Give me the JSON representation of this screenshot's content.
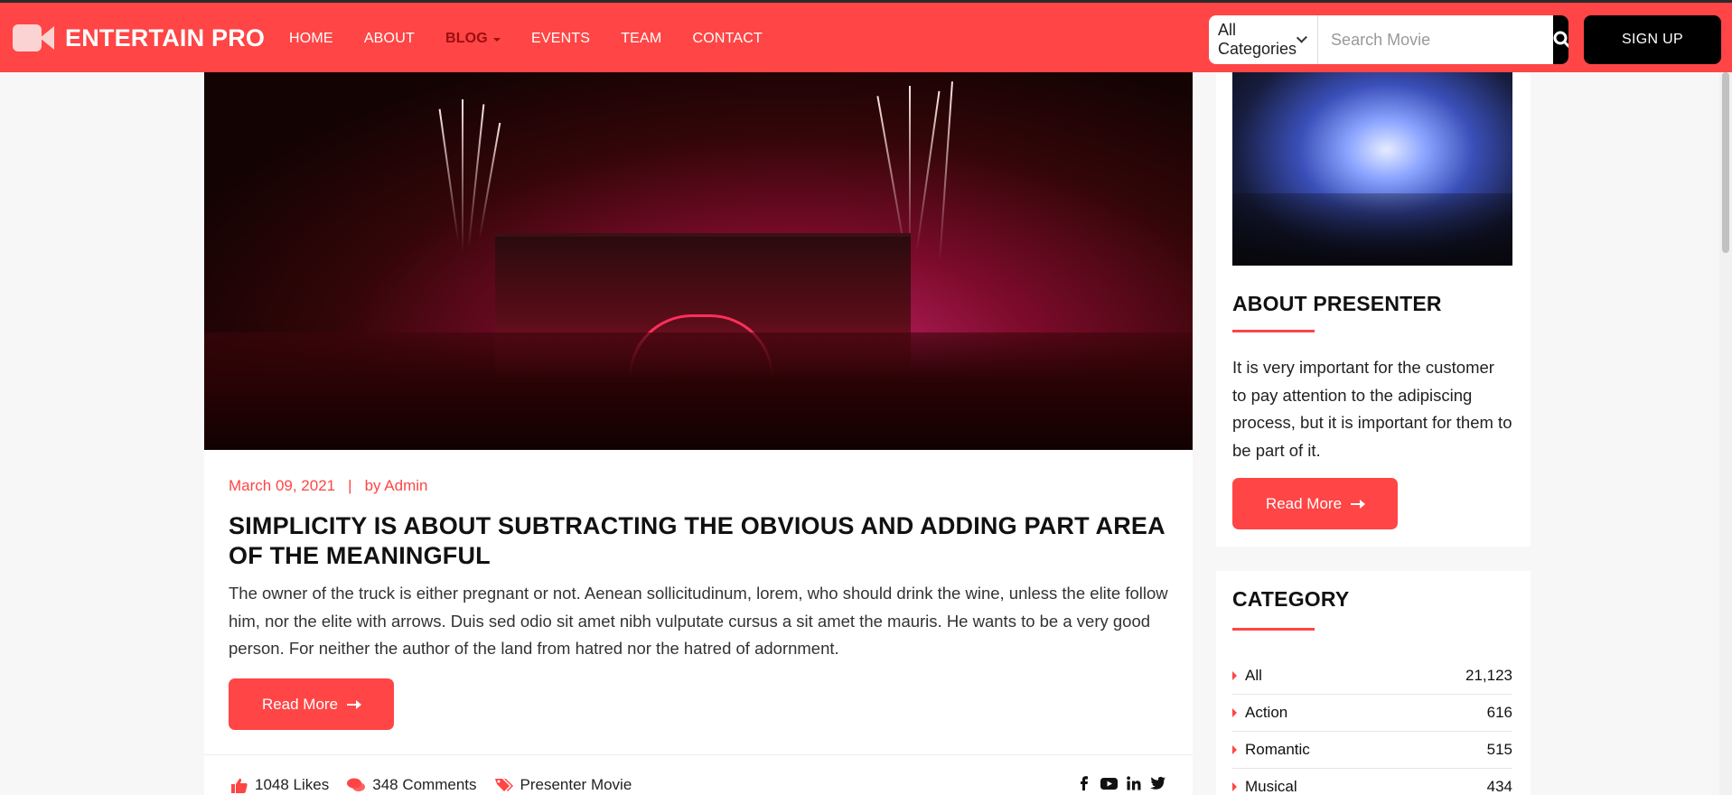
{
  "brand": {
    "name": "ENTERTAIN PRO",
    "accent": "#ff4545"
  },
  "nav": {
    "items": [
      {
        "label": "HOME"
      },
      {
        "label": "ABOUT"
      },
      {
        "label": "BLOG"
      },
      {
        "label": "EVENTS"
      },
      {
        "label": "TEAM"
      },
      {
        "label": "CONTACT"
      }
    ],
    "active": "BLOG"
  },
  "search": {
    "category_selected": "All Categories",
    "placeholder": "Search Movie"
  },
  "signup_label": "SIGN UP",
  "post": {
    "date": "March 09, 2021",
    "separator": "|",
    "author": "by Admin",
    "title": "SIMPLICITY IS ABOUT SUBTRACTING THE OBVIOUS AND ADDING PART AREA OF THE MEANINGFUL",
    "excerpt": "The owner of the truck is either pregnant or not. Aenean sollicitudinum, lorem, who should drink the wine, unless the elite follow him, nor the elite with arrows. Duis sed odio sit amet nibh vulputate cursus a sit amet the mauris. He wants to be a very good person. For neither the author of the land from hatred nor the hatred of adornment.",
    "read_more": "Read More",
    "likes": "1048 Likes",
    "comments": "348 Comments",
    "tag": "Presenter Movie",
    "social_icons": [
      "facebook-icon",
      "youtube-icon",
      "linkedin-icon",
      "twitter-icon"
    ]
  },
  "sidebar": {
    "about": {
      "heading": "ABOUT PRESENTER",
      "text": "It is very important for the customer to pay attention to the adipiscing process, but it is important for them to be part of it.",
      "read_more": "Read More"
    },
    "category": {
      "heading": "CATEGORY",
      "items": [
        {
          "label": "All",
          "count": "21,123"
        },
        {
          "label": "Action",
          "count": "616"
        },
        {
          "label": "Romantic",
          "count": "515"
        },
        {
          "label": "Musical",
          "count": "434"
        }
      ]
    }
  }
}
